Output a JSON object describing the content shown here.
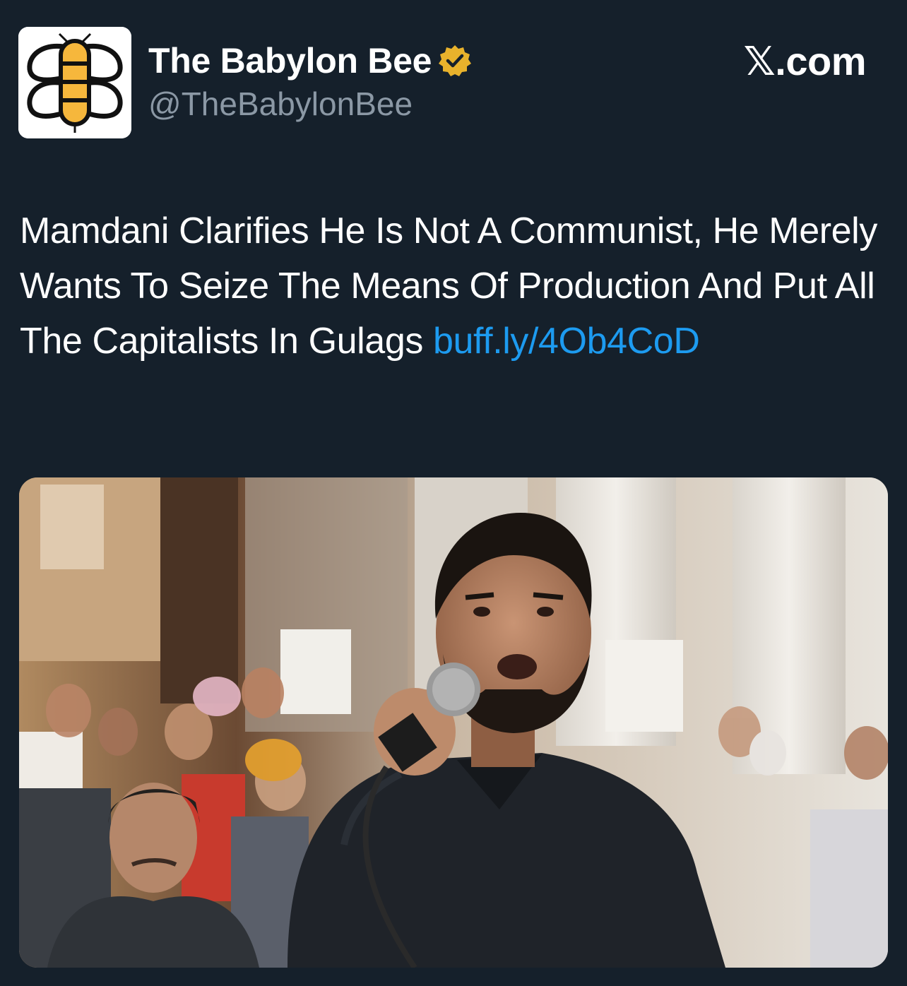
{
  "tweet": {
    "author": {
      "display_name": "The Babylon Bee",
      "handle": "@TheBabylonBee",
      "verified": true,
      "verified_badge_color": "#e8b22c"
    },
    "site_label": "𝕏.com",
    "text": "Mamdani Clarifies He Is Not A Communist, He Merely Wants To Seize The Means Of Production And Put All The Capitalists In Gulags",
    "link_text": "buff.ly/4Ob4CoD",
    "link_color": "#1d9bf0"
  },
  "icons": {
    "avatar": "babylon-bee-logo",
    "badge": "verified-badge-icon"
  },
  "colors": {
    "background": "#15202b",
    "handle_text": "#8b98a5",
    "logo_yellow": "#f6b73c"
  }
}
